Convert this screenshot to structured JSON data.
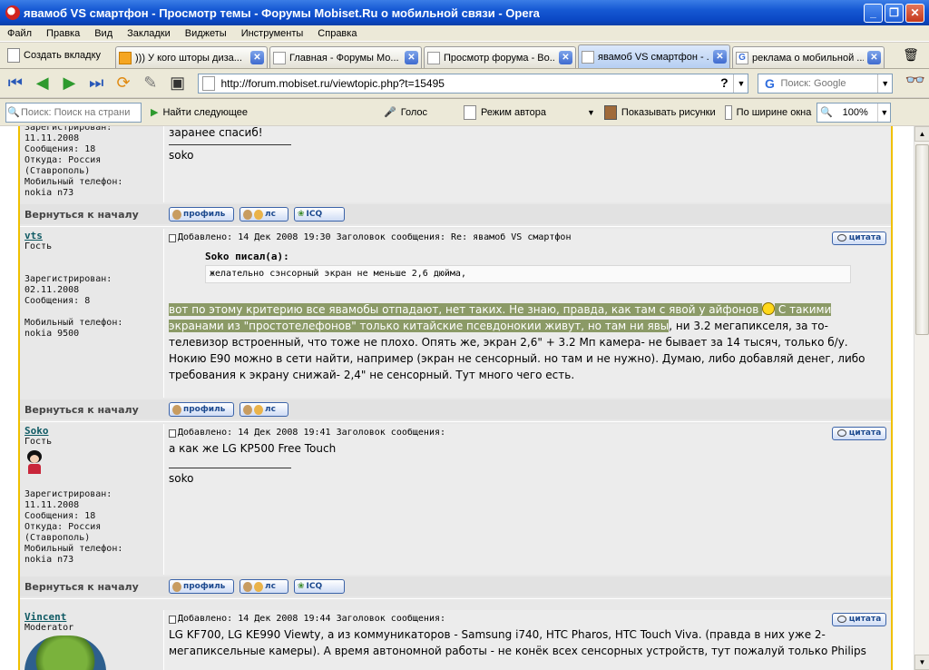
{
  "window": {
    "title": "явамоб VS смартфон - Просмотр темы - Форумы Mobiset.Ru о мобильной связи - Opera"
  },
  "menu": [
    "Файл",
    "Правка",
    "Вид",
    "Закладки",
    "Виджеты",
    "Инструменты",
    "Справка"
  ],
  "tabs": {
    "new_tab": "Создать вкладку",
    "items": [
      {
        "label": "))) У кого шторы диза..."
      },
      {
        "label": "Главная - Форумы Мо..."
      },
      {
        "label": "Просмотр форума - Во..."
      },
      {
        "label": "явамоб VS смартфон - ..."
      },
      {
        "label": "реклама о мобильной ..."
      }
    ]
  },
  "address": {
    "url": "http://forum.mobiset.ru/viewtopic.php?t=15495",
    "search_placeholder": "Поиск: Google"
  },
  "findbar": {
    "placeholder": "Поиск: Поиск на страни",
    "find_next": "Найти следующее",
    "voice": "Голос",
    "author_mode": "Режим автора",
    "show_images": "Показывать рисунки",
    "fit_width": "По ширине окна",
    "zoom": "100%"
  },
  "common": {
    "back_to_top": "Вернуться к началу",
    "profile": "профиль",
    "pm": "лс",
    "icq": "ICQ",
    "quote": "цитата"
  },
  "posts": [
    {
      "author_lines": [
        "Зарегистрирован:",
        "11.11.2008",
        "Сообщения: 18",
        "Откуда: Россия",
        "(Ставрополь)",
        "Мобильный телефон:",
        "nokia n73"
      ],
      "text": "заранее спасиб!",
      "signature": "soko"
    },
    {
      "nick": "vts",
      "rank": "Гость",
      "author_lines": [
        "Зарегистрирован:",
        "02.11.2008",
        "Сообщения: 8",
        "",
        "Мобильный телефон:",
        "nokia 9500"
      ],
      "meta": "Добавлено: 14 Дек 2008 19:30   Заголовок сообщения: Re: явамоб VS смартфон",
      "quote_title": "Soko писал(а):",
      "quote_text": "желательно сэнсорный экран не меньше 2,6 дюйма,",
      "text_hl1": "вот по этому критерию все явамобы отпадают, нет таких. Не знаю, правда, как там с явой у айфонов ",
      "text_hl2": " С такими экранами из \"простотелефонов\" только китайские псевдонокии живут, но там ни явы",
      "text_rest": ", ни 3.2 мегапикселя, за то- телевизор встроенный, что тоже не плохо. Опять же, экран 2,6\" + 3.2 Мп камера- не бывает за 14 тысяч, только б/у. Нокию Е90 можно в сети найти, например (экран не сенсорный. но там и не нужно). Думаю, либо добавляй денег, либо требования к экрану снижай- 2,4\" не сенсорный. Тут много чего есть."
    },
    {
      "nick": "Soko",
      "rank": "Гость",
      "author_lines": [
        "Зарегистрирован:",
        "11.11.2008",
        "Сообщения: 18",
        "Откуда: Россия",
        "(Ставрополь)",
        "Мобильный телефон:",
        "nokia n73"
      ],
      "meta": "Добавлено: 14 Дек 2008 19:41   Заголовок сообщения:",
      "text": "а как же LG KP500 Free Touch",
      "signature": "soko"
    },
    {
      "nick": "Vincent",
      "rank": "Moderator",
      "meta": "Добавлено: 14 Дек 2008 19:44   Заголовок сообщения:",
      "text": "LG KF700, LG KE990 Viewty, а из коммуникаторов - Samsung i740, HTC Pharos, HTC Touch Viva. (правда в них уже 2-мегапиксельные камеры). А время автономной работы - не конёк всех сенсорных устройств, тут пожалуй только Philips"
    }
  ]
}
